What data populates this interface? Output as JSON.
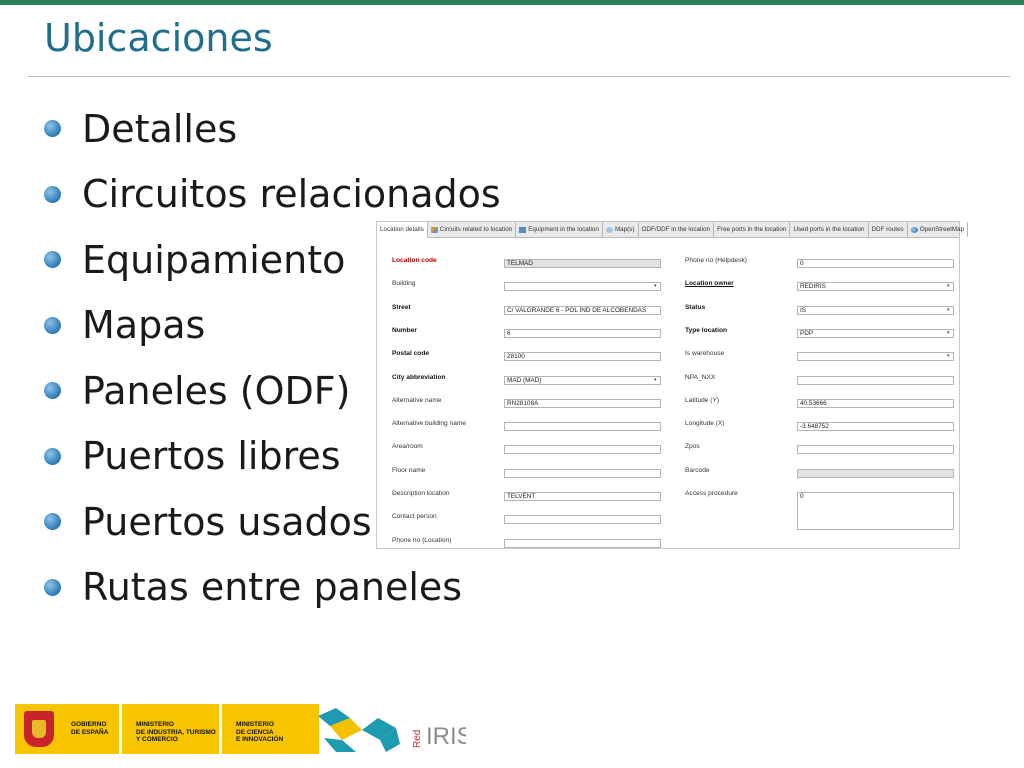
{
  "slide": {
    "title": "Ubicaciones",
    "bullets": [
      "Detalles",
      "Circuitos relacionados",
      "Equipamiento",
      "Mapas",
      "Paneles (ODF)",
      "Puertos libres",
      "Puertos usados",
      "Rutas entre paneles"
    ]
  },
  "screenshot": {
    "tabs": [
      {
        "label": "Location details",
        "icon": "none",
        "active": true
      },
      {
        "label": "Circuits related to location",
        "icon": "link-icon"
      },
      {
        "label": "Equipment in the location",
        "icon": "equipment-icon"
      },
      {
        "label": "Map(s)",
        "icon": "map-icon"
      },
      {
        "label": "ODF/DDF in the location",
        "icon": "none"
      },
      {
        "label": "Free ports in the location",
        "icon": "none"
      },
      {
        "label": "Used ports in the location",
        "icon": "none"
      },
      {
        "label": "DDF routes",
        "icon": "none"
      },
      {
        "label": "OpenStreetMap",
        "icon": "globe-icon"
      }
    ],
    "left_fields": [
      {
        "label": "Location code",
        "value": "TELMAD",
        "style": "required",
        "readonly": true
      },
      {
        "label": "Building",
        "value": "",
        "style": "normal",
        "dropdown": true
      },
      {
        "label": "Street",
        "value": "C/ VALGRANDE 6 - POL IND DE ALCOBENDAS",
        "style": "bold"
      },
      {
        "label": "Number",
        "value": "6",
        "style": "bold"
      },
      {
        "label": "Postal code",
        "value": "28100",
        "style": "bold"
      },
      {
        "label": "City abbreviation",
        "value": "MAD (MAD)",
        "style": "bold",
        "dropdown": true
      },
      {
        "label": "Alternative name",
        "value": "RN28108A",
        "style": "normal"
      },
      {
        "label": "Alternative building name",
        "value": "",
        "style": "normal"
      },
      {
        "label": "Area/room",
        "value": "",
        "style": "normal"
      },
      {
        "label": "Floor name",
        "value": "",
        "style": "normal"
      },
      {
        "label": "Description location",
        "value": "TELVENT",
        "style": "normal"
      },
      {
        "label": "Contact person",
        "value": "",
        "style": "normal"
      },
      {
        "label": "Phone no (Location)",
        "value": "",
        "style": "normal"
      }
    ],
    "right_fields": [
      {
        "label": "Phone no (Helpdesk)",
        "value": "0",
        "style": "normal"
      },
      {
        "label": "Location owner",
        "value": "REDIRIS",
        "style": "bold-underline",
        "dropdown": true
      },
      {
        "label": "Status",
        "value": "IS",
        "style": "bold",
        "dropdown": true
      },
      {
        "label": "Type location",
        "value": "PDP",
        "style": "bold",
        "dropdown": true
      },
      {
        "label": "Is warehouse",
        "value": "",
        "style": "normal",
        "dropdown": true
      },
      {
        "label": "NPA_NXX",
        "value": "",
        "style": "normal"
      },
      {
        "label": "Latitude (Y)",
        "value": "40.53666",
        "style": "normal"
      },
      {
        "label": "Longitude (X)",
        "value": "-3.648752",
        "style": "normal"
      },
      {
        "label": "Zpos",
        "value": "",
        "style": "normal"
      },
      {
        "label": "Barcode",
        "value": "",
        "style": "normal",
        "readonly": true
      },
      {
        "label": "Access procedure",
        "value": "0",
        "style": "normal",
        "textarea": true
      }
    ]
  },
  "footer": {
    "gobierno": "GOBIERNO\nDE ESPAÑA",
    "ministerio1": "MINISTERIO\nDE INDUSTRIA, TURISMO\nY COMERCIO",
    "ministerio2": "MINISTERIO\nDE CIENCIA\nE INNOVACIÓN",
    "red": "Red",
    "iris": "IRIS"
  },
  "colors": {
    "title": "#1f6f8b",
    "top_rule": "#2e7d5b",
    "bullet": "#2a79b8",
    "required_label": "#b00000",
    "logo_yellow": "#f6c500"
  }
}
